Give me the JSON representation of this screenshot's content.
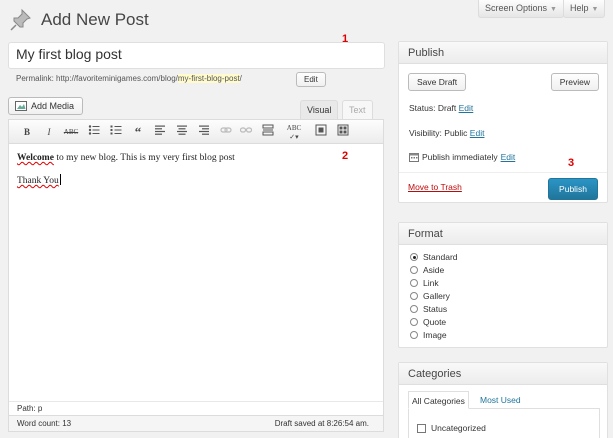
{
  "header": {
    "title": "Add New Post",
    "screen_options": "Screen Options",
    "help": "Help"
  },
  "post": {
    "title_value": "My first blog post",
    "permalink_label": "Permalink:",
    "permalink_base": "http://favoriteminigames.com/blog/",
    "permalink_slug": "my-first-blog-post",
    "permalink_trail": "/",
    "edit_label": "Edit"
  },
  "editor": {
    "add_media": "Add Media",
    "tab_visual": "Visual",
    "tab_text": "Text",
    "toolbar": [
      "bold-icon",
      "italic-icon",
      "strikethrough-icon",
      "bullet-list-icon",
      "numbered-list-icon",
      "blockquote-icon",
      "align-left-icon",
      "align-center-icon",
      "align-right-icon",
      "insert-link-icon",
      "unlink-icon",
      "insert-more-icon",
      "spellcheck-icon",
      "fullscreen-icon",
      "kitchen-sink-icon"
    ],
    "content_bold": "Welcome",
    "content_rest": " to my new blog. This is my very first blog post",
    "content_line2": "Thank You",
    "path": "Path: p",
    "word_count": "Word count: 13",
    "draft_saved": "Draft saved at 8:26:54 am."
  },
  "annotations": {
    "one": "1",
    "two": "2",
    "three": "3"
  },
  "publish": {
    "heading": "Publish",
    "save_draft": "Save Draft",
    "preview": "Preview",
    "status_label": "Status: Draft",
    "visibility_label": "Visibility: Public",
    "schedule_label": "Publish immediately",
    "edit": "Edit",
    "move_to_trash": "Move to Trash",
    "publish_button": "Publish"
  },
  "format": {
    "heading": "Format",
    "options": [
      "Standard",
      "Aside",
      "Link",
      "Gallery",
      "Status",
      "Quote",
      "Image"
    ],
    "selected": "Standard"
  },
  "categories": {
    "heading": "Categories",
    "tab_all": "All Categories",
    "tab_most_used": "Most Used",
    "items": [
      "Uncategorized"
    ]
  },
  "colors": {
    "accent": "#21759b",
    "trash": "#bc0b0b",
    "annotation": "#dd0000",
    "slug_highlight": "#fffbcc"
  }
}
